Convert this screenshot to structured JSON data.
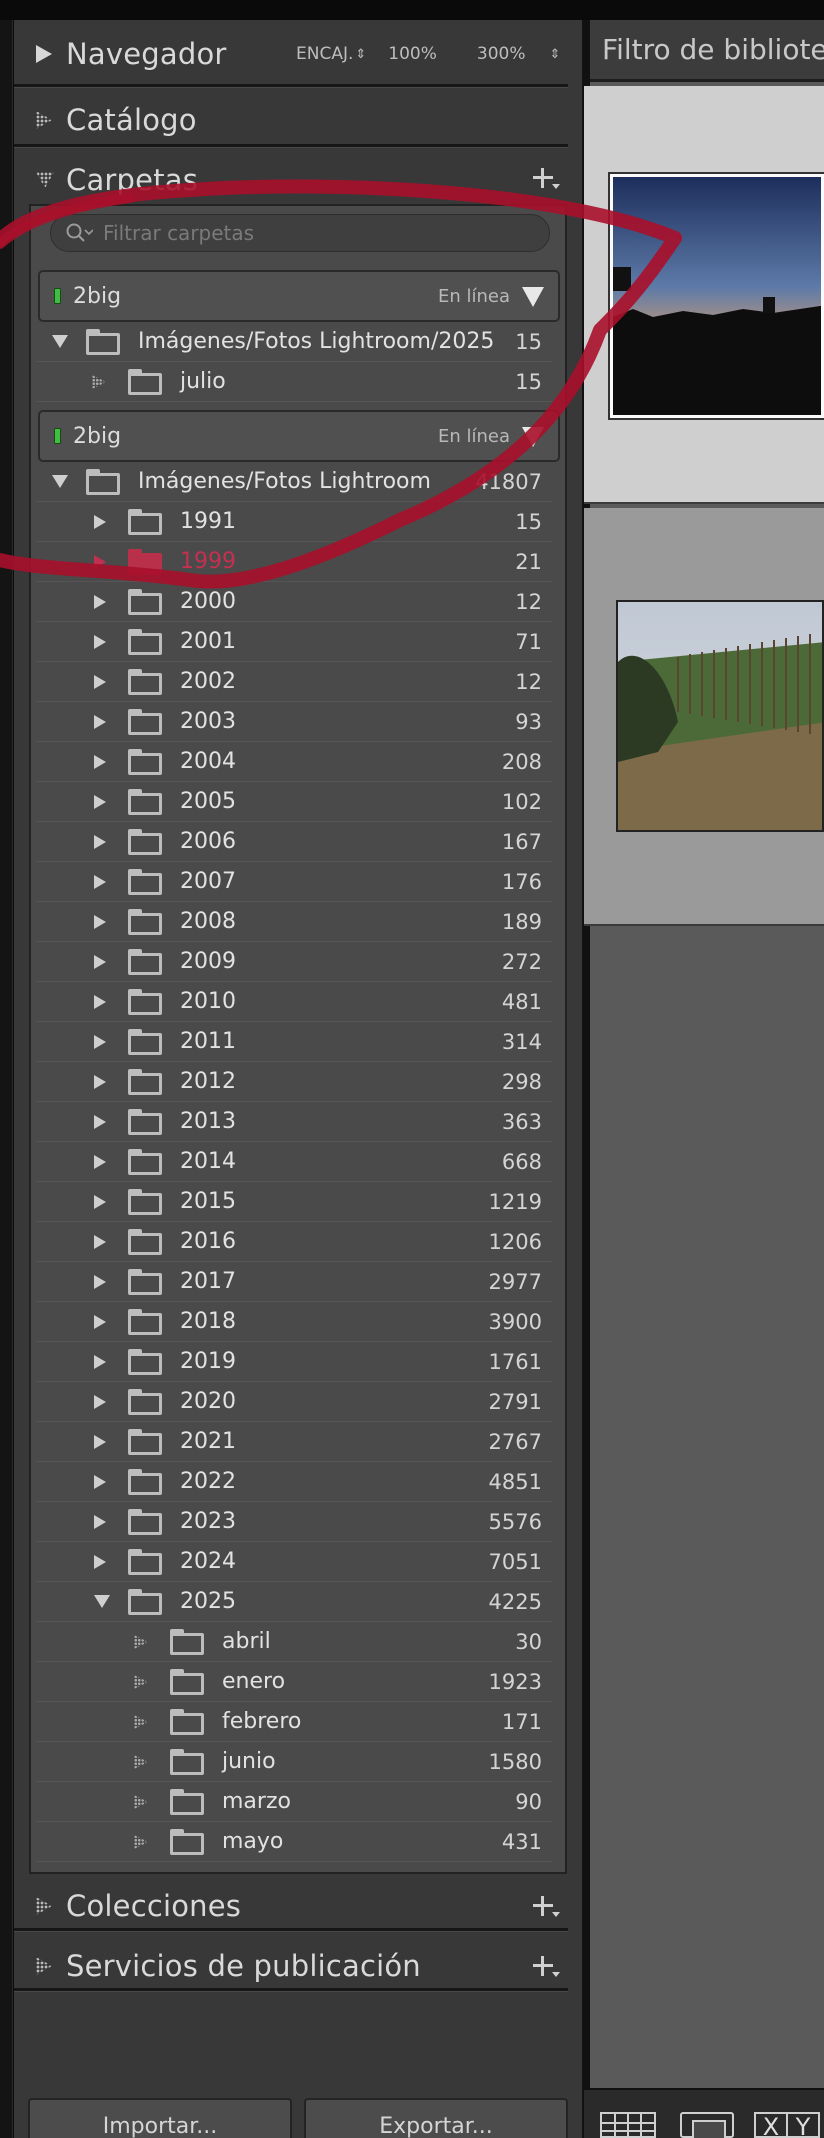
{
  "navigator": {
    "title": "Navegador",
    "fit": "ENCAJ.",
    "zoom1": "100%",
    "zoom2": "300%"
  },
  "catalog": {
    "title": "Catálogo"
  },
  "folders": {
    "title": "Carpetas",
    "filter_placeholder": "Filtrar carpetas",
    "volume1": {
      "name": "2big",
      "status": "En línea"
    },
    "volume1_rows": [
      {
        "label": "Imágenes/Fotos Lightroom/2025",
        "count": "15"
      },
      {
        "label": "julio",
        "count": "15"
      }
    ],
    "volume2": {
      "name": "2big",
      "status": "En línea"
    },
    "root": {
      "label": "Imágenes/Fotos Lightroom",
      "count": "41807"
    },
    "years": [
      {
        "label": "1991",
        "count": "15"
      },
      {
        "label": "1999",
        "count": "21"
      },
      {
        "label": "2000",
        "count": "12"
      },
      {
        "label": "2001",
        "count": "71"
      },
      {
        "label": "2002",
        "count": "12"
      },
      {
        "label": "2003",
        "count": "93"
      },
      {
        "label": "2004",
        "count": "208"
      },
      {
        "label": "2005",
        "count": "102"
      },
      {
        "label": "2006",
        "count": "167"
      },
      {
        "label": "2007",
        "count": "176"
      },
      {
        "label": "2008",
        "count": "189"
      },
      {
        "label": "2009",
        "count": "272"
      },
      {
        "label": "2010",
        "count": "481"
      },
      {
        "label": "2011",
        "count": "314"
      },
      {
        "label": "2012",
        "count": "298"
      },
      {
        "label": "2013",
        "count": "363"
      },
      {
        "label": "2014",
        "count": "668"
      },
      {
        "label": "2015",
        "count": "1219"
      },
      {
        "label": "2016",
        "count": "1206"
      },
      {
        "label": "2017",
        "count": "2977"
      },
      {
        "label": "2018",
        "count": "3900"
      },
      {
        "label": "2019",
        "count": "1761"
      },
      {
        "label": "2020",
        "count": "2791"
      },
      {
        "label": "2021",
        "count": "2767"
      },
      {
        "label": "2022",
        "count": "4851"
      },
      {
        "label": "2023",
        "count": "5576"
      },
      {
        "label": "2024",
        "count": "7051"
      },
      {
        "label": "2025",
        "count": "4225"
      }
    ],
    "months_2025": [
      {
        "label": "abril",
        "count": "30"
      },
      {
        "label": "enero",
        "count": "1923"
      },
      {
        "label": "febrero",
        "count": "171"
      },
      {
        "label": "junio",
        "count": "1580"
      },
      {
        "label": "marzo",
        "count": "90"
      },
      {
        "label": "mayo",
        "count": "431"
      }
    ]
  },
  "collections": {
    "title": "Colecciones"
  },
  "publish": {
    "title": "Servicios de publicación"
  },
  "buttons": {
    "import": "Importar...",
    "export": "Exportar..."
  },
  "library_filter": {
    "title": "Filtro de biblioteca"
  },
  "toolbar": {
    "x": "X",
    "y": "Y"
  },
  "colors": {
    "annotation": "#b0102a",
    "online": "#3fbf3f",
    "highlight": "#c53050"
  }
}
